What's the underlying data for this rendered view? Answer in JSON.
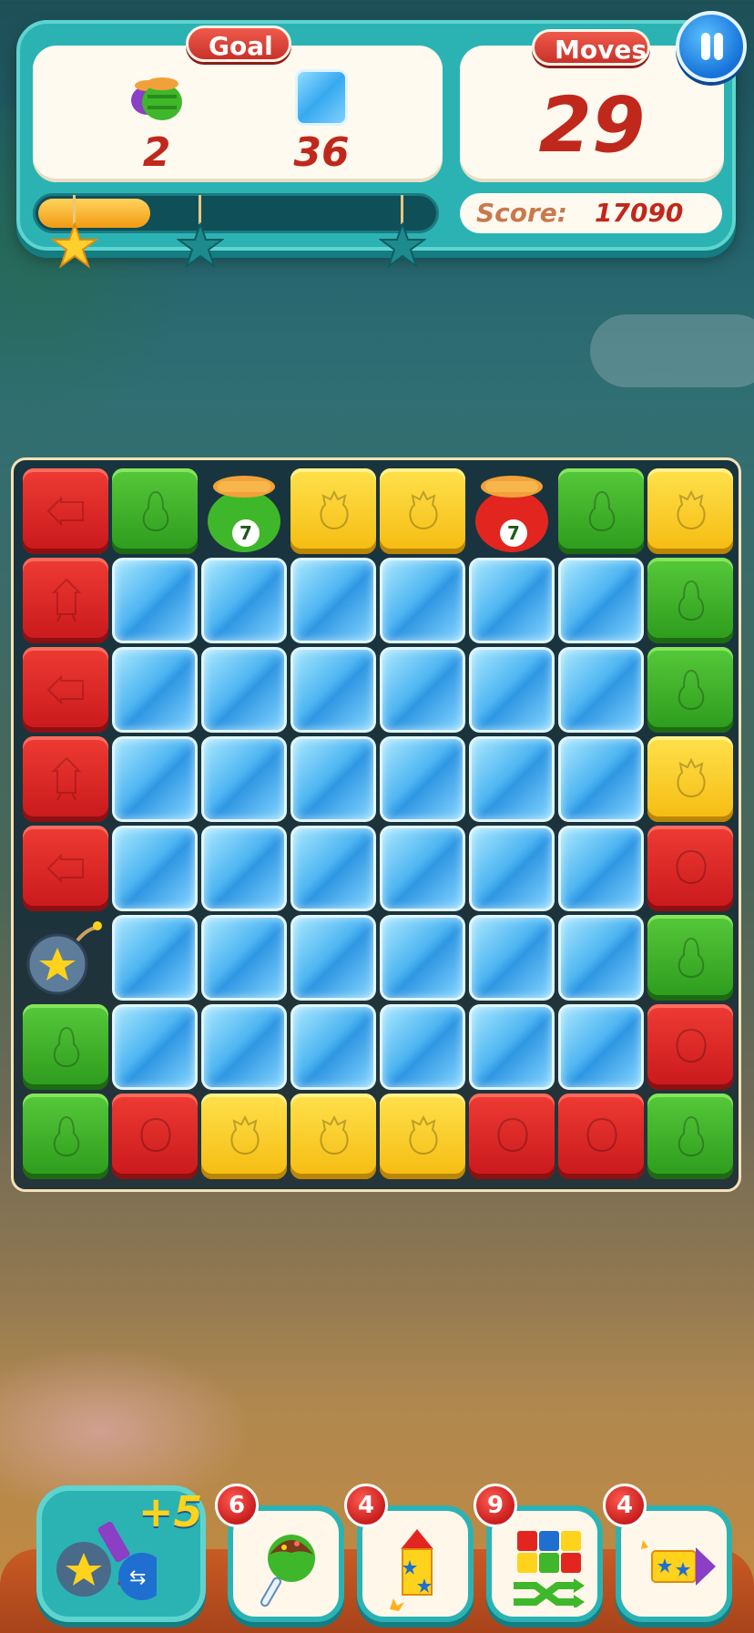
{
  "header": {
    "goal_label": "Goal",
    "moves_label": "Moves",
    "goals": [
      {
        "icon": "jar-icon",
        "count": "2"
      },
      {
        "icon": "ice-block-icon",
        "count": "36"
      }
    ],
    "moves": "29",
    "score_label": "Score:",
    "score_value": "17090",
    "progress_fraction": 0.28,
    "stars_earned": 1,
    "stars_total": 3
  },
  "board": {
    "columns": 8,
    "rows": 8,
    "grid": [
      [
        "red-rocket",
        "green",
        "green-jar",
        "yellow",
        "yellow",
        "red-jar",
        "green",
        "yellow"
      ],
      [
        "red-rocket-up",
        "ice",
        "ice",
        "ice",
        "ice",
        "ice",
        "ice",
        "green"
      ],
      [
        "red-rocket",
        "ice",
        "ice",
        "ice",
        "ice",
        "ice",
        "ice",
        "green"
      ],
      [
        "red-rocket-up",
        "ice",
        "ice",
        "ice",
        "ice",
        "ice",
        "ice",
        "yellow"
      ],
      [
        "red-rocket",
        "ice",
        "ice",
        "ice",
        "ice",
        "ice",
        "ice",
        "red"
      ],
      [
        "bomb",
        "ice",
        "ice",
        "ice",
        "ice",
        "ice",
        "ice",
        "green"
      ],
      [
        "green",
        "ice",
        "ice",
        "ice",
        "ice",
        "ice",
        "ice",
        "red"
      ],
      [
        "green",
        "red",
        "yellow",
        "yellow",
        "yellow",
        "red",
        "red",
        "green"
      ]
    ],
    "jar_counter": "7"
  },
  "boosters": {
    "combo": {
      "label": "+5"
    },
    "items": [
      {
        "name": "candy-apple",
        "count": "6"
      },
      {
        "name": "firework-rocket",
        "count": "4"
      },
      {
        "name": "shuffle",
        "count": "9"
      },
      {
        "name": "cannon",
        "count": "4"
      }
    ]
  },
  "colors": {
    "panel_teal": "#2bb3b4",
    "goal_red": "#c0281c",
    "block_red": "#e2261f",
    "block_green": "#3fb72a",
    "block_yellow": "#fbcc1e",
    "ice_blue": "#4fb6f2"
  }
}
